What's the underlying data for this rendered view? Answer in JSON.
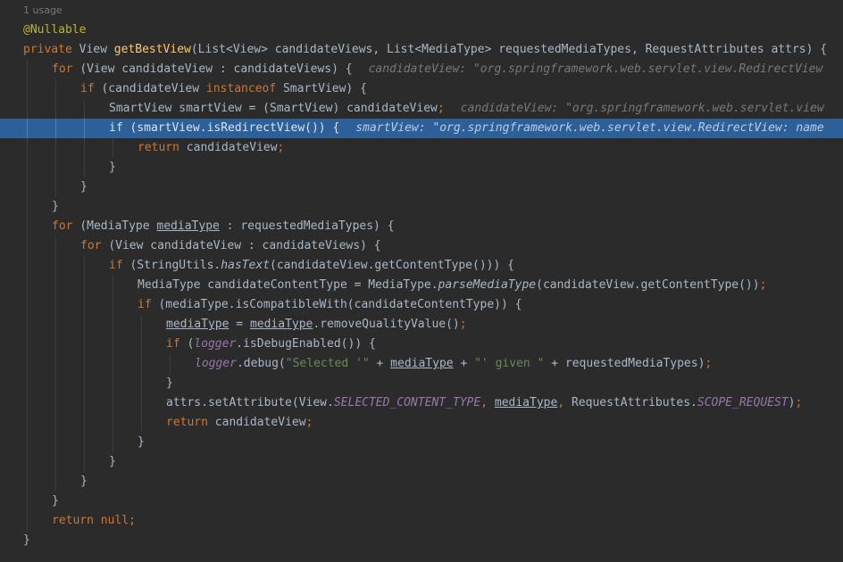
{
  "editor": {
    "usage_label": "1 usage",
    "lines": [
      {
        "indent": 0,
        "tokens": [
          {
            "t": "@Nullable",
            "c": "ann"
          }
        ]
      },
      {
        "indent": 0,
        "tokens": [
          {
            "t": "private ",
            "c": "kw"
          },
          {
            "t": "View "
          },
          {
            "t": "getBestView",
            "c": "fn"
          },
          {
            "t": "(List<View> candidateViews, List<MediaType> requestedMediaTypes, RequestAttributes attrs) {"
          }
        ]
      },
      {
        "indent": 1,
        "tokens": [
          {
            "t": "for ",
            "c": "kw"
          },
          {
            "t": "(View candidateView : candidateViews) {"
          }
        ],
        "hint": "candidateView: \"org.springframework.web.servlet.view.RedirectView"
      },
      {
        "indent": 2,
        "tokens": [
          {
            "t": "if ",
            "c": "kw"
          },
          {
            "t": "(candidateView "
          },
          {
            "t": "instanceof ",
            "c": "kw"
          },
          {
            "t": "SmartView) {"
          }
        ]
      },
      {
        "indent": 3,
        "tokens": [
          {
            "t": "SmartView smartView = (SmartView) candidateView"
          },
          {
            "t": ";",
            "c": "kw"
          }
        ],
        "hint": "candidateView: \"org.springframework.web.servlet.view"
      },
      {
        "indent": 3,
        "exec": true,
        "tokens": [
          {
            "t": "if ",
            "c": "kw"
          },
          {
            "t": "(smartView.isRedirectView()) {"
          }
        ],
        "hint": "smartView: \"org.springframework.web.servlet.view.RedirectView: name"
      },
      {
        "indent": 4,
        "tokens": [
          {
            "t": "return ",
            "c": "kw"
          },
          {
            "t": "candidateView"
          },
          {
            "t": ";",
            "c": "kw"
          }
        ]
      },
      {
        "indent": 3,
        "tokens": [
          {
            "t": "}"
          }
        ]
      },
      {
        "indent": 2,
        "tokens": [
          {
            "t": "}"
          }
        ]
      },
      {
        "indent": 1,
        "tokens": [
          {
            "t": "}"
          }
        ]
      },
      {
        "indent": 1,
        "tokens": [
          {
            "t": "for ",
            "c": "kw"
          },
          {
            "t": "(MediaType "
          },
          {
            "t": "mediaType",
            "c": "ul"
          },
          {
            "t": " : requestedMediaTypes) {"
          }
        ]
      },
      {
        "indent": 2,
        "tokens": [
          {
            "t": "for ",
            "c": "kw"
          },
          {
            "t": "(View candidateView : candidateViews) {"
          }
        ]
      },
      {
        "indent": 3,
        "tokens": [
          {
            "t": "if ",
            "c": "kw"
          },
          {
            "t": "(StringUtils."
          },
          {
            "t": "hasText",
            "c": "ital"
          },
          {
            "t": "(candidateView.getContentType())) {"
          }
        ]
      },
      {
        "indent": 4,
        "tokens": [
          {
            "t": "MediaType candidateContentType = MediaType."
          },
          {
            "t": "parseMediaType",
            "c": "ital"
          },
          {
            "t": "(candidateView.getContentType())"
          },
          {
            "t": ";",
            "c": "kw"
          }
        ]
      },
      {
        "indent": 4,
        "tokens": [
          {
            "t": "if ",
            "c": "kw"
          },
          {
            "t": "(mediaType.isCompatibleWith(candidateContentType)) {"
          }
        ]
      },
      {
        "indent": 5,
        "tokens": [
          {
            "t": "mediaType",
            "c": "ul"
          },
          {
            "t": " = "
          },
          {
            "t": "mediaType",
            "c": "ul"
          },
          {
            "t": ".removeQualityValue()"
          },
          {
            "t": ";",
            "c": "kw"
          }
        ]
      },
      {
        "indent": 5,
        "tokens": [
          {
            "t": "if ",
            "c": "kw"
          },
          {
            "t": "("
          },
          {
            "t": "logger",
            "c": "static"
          },
          {
            "t": ".isDebugEnabled()) {"
          }
        ]
      },
      {
        "indent": 6,
        "tokens": [
          {
            "t": "logger",
            "c": "static"
          },
          {
            "t": ".debug("
          },
          {
            "t": "\"Selected '\"",
            "c": "str"
          },
          {
            "t": " + "
          },
          {
            "t": "mediaType",
            "c": "ul"
          },
          {
            "t": " + "
          },
          {
            "t": "\"' given \"",
            "c": "str"
          },
          {
            "t": " + requestedMediaTypes)"
          },
          {
            "t": ";",
            "c": "kw"
          }
        ]
      },
      {
        "indent": 5,
        "tokens": [
          {
            "t": "}"
          }
        ]
      },
      {
        "indent": 5,
        "tokens": [
          {
            "t": "attrs.setAttribute(View."
          },
          {
            "t": "SELECTED_CONTENT_TYPE",
            "c": "static"
          },
          {
            "t": ", ",
            "c": "kw"
          },
          {
            "t": "mediaType",
            "c": "ul"
          },
          {
            "t": ", ",
            "c": "kw"
          },
          {
            "t": "RequestAttributes."
          },
          {
            "t": "SCOPE_REQUEST",
            "c": "static"
          },
          {
            "t": ")"
          },
          {
            "t": ";",
            "c": "kw"
          }
        ]
      },
      {
        "indent": 5,
        "tokens": [
          {
            "t": "return ",
            "c": "kw"
          },
          {
            "t": "candidateView"
          },
          {
            "t": ";",
            "c": "kw"
          }
        ]
      },
      {
        "indent": 4,
        "tokens": [
          {
            "t": "}"
          }
        ]
      },
      {
        "indent": 3,
        "tokens": [
          {
            "t": "}"
          }
        ]
      },
      {
        "indent": 2,
        "tokens": [
          {
            "t": "}"
          }
        ]
      },
      {
        "indent": 1,
        "tokens": [
          {
            "t": "}"
          }
        ]
      },
      {
        "indent": 1,
        "tokens": [
          {
            "t": "return null",
            "c": "kw"
          },
          {
            "t": ";",
            "c": "kw"
          }
        ]
      },
      {
        "indent": 0,
        "tokens": [
          {
            "t": "}"
          }
        ]
      }
    ]
  }
}
